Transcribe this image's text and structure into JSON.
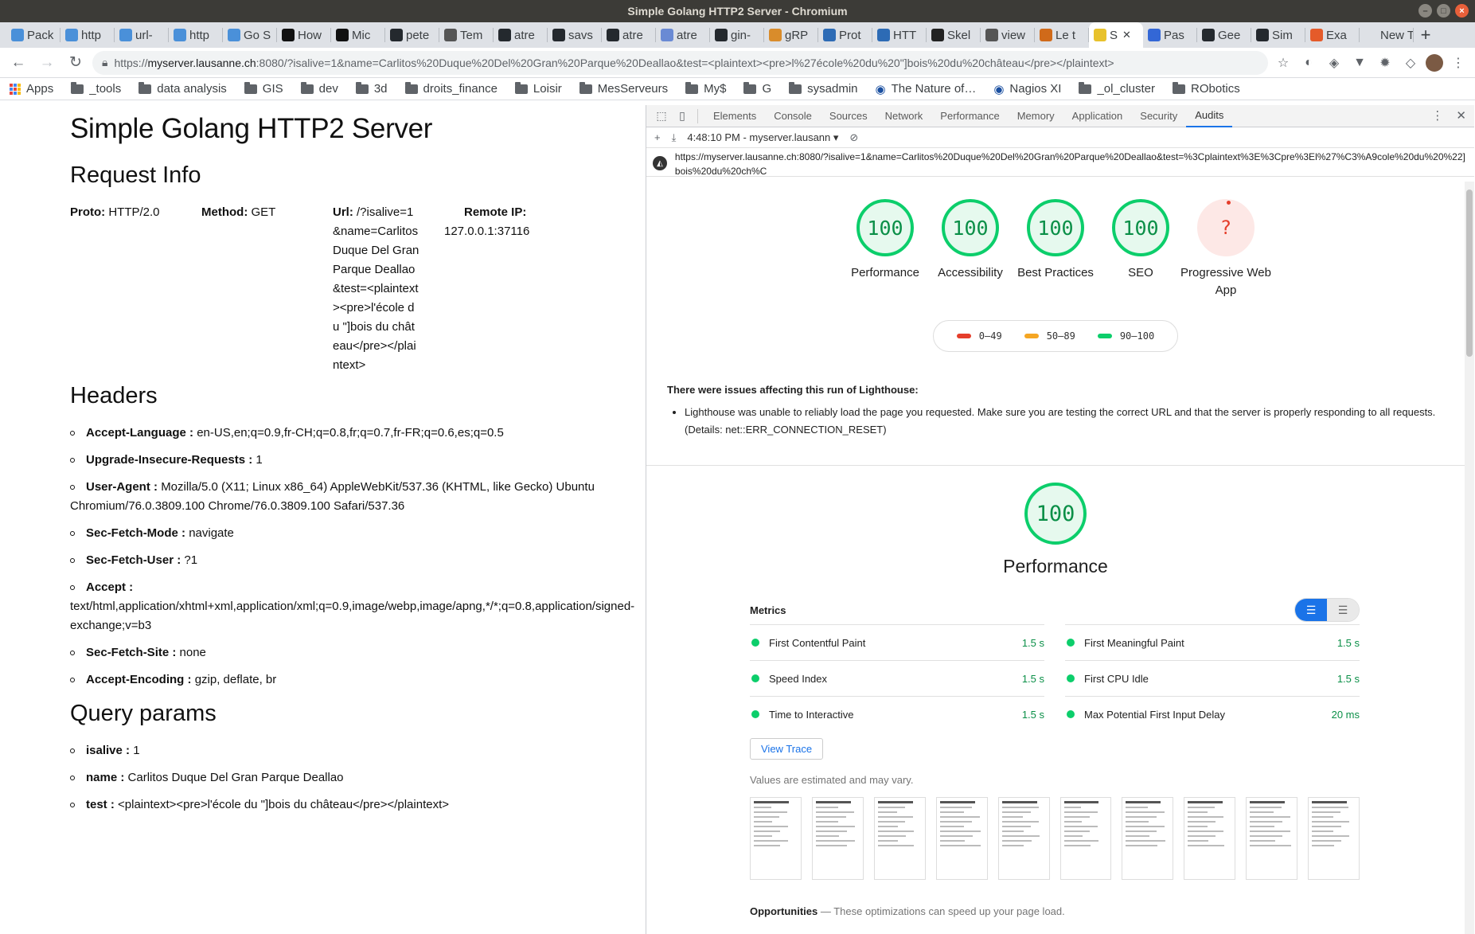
{
  "window": {
    "title": "Simple Golang HTTP2 Server - Chromium"
  },
  "tabs": [
    {
      "label": "Pack",
      "color": "#4a90d9"
    },
    {
      "label": "http",
      "color": "#4a90d9"
    },
    {
      "label": "url-",
      "color": "#4a90d9"
    },
    {
      "label": "http",
      "color": "#4a90d9"
    },
    {
      "label": "Go S",
      "color": "#4a90d9"
    },
    {
      "label": "How",
      "color": "#111111"
    },
    {
      "label": "Mic",
      "color": "#111111"
    },
    {
      "label": "pete",
      "color": "#24292e"
    },
    {
      "label": "Tem",
      "color": "#555555"
    },
    {
      "label": "atre",
      "color": "#24292e"
    },
    {
      "label": "savs",
      "color": "#24292e"
    },
    {
      "label": "atre",
      "color": "#24292e"
    },
    {
      "label": "atre",
      "color": "#6a8ad4"
    },
    {
      "label": "gin-",
      "color": "#24292e"
    },
    {
      "label": "gRP",
      "color": "#d98c2b"
    },
    {
      "label": "Prot",
      "color": "#2d6bb5"
    },
    {
      "label": "HTT",
      "color": "#2d6bb5"
    },
    {
      "label": "Skel",
      "color": "#222222"
    },
    {
      "label": "view",
      "color": "#555555"
    },
    {
      "label": "Le t",
      "color": "#d06a1a"
    },
    {
      "label": "S",
      "color": "#e8c22c",
      "active": true
    },
    {
      "label": "Pas",
      "color": "#3367d6"
    },
    {
      "label": "Gee",
      "color": "#24292e"
    },
    {
      "label": "Sim",
      "color": "#24292e"
    },
    {
      "label": "Exa",
      "color": "#e55b2a"
    },
    {
      "label": "New Ta",
      "color": "#dee1e6"
    }
  ],
  "omnibox": {
    "url_prefix": "https://",
    "host": "myserver.lausanne.ch",
    "url_rest": ":8080/?isalive=1&name=Carlitos%20Duque%20Del%20Gran%20Parque%20Deallao&test=<plaintext><pre>l%27école%20du%20\"]bois%20du%20château</pre></plaintext>"
  },
  "bookmarks": [
    {
      "label": "Apps",
      "type": "apps"
    },
    {
      "label": "_tools",
      "type": "folder"
    },
    {
      "label": "data analysis",
      "type": "folder"
    },
    {
      "label": "GIS",
      "type": "folder"
    },
    {
      "label": "dev",
      "type": "folder"
    },
    {
      "label": "3d",
      "type": "folder"
    },
    {
      "label": "droits_finance",
      "type": "folder"
    },
    {
      "label": "Loisir",
      "type": "folder"
    },
    {
      "label": "MesServeurs",
      "type": "folder"
    },
    {
      "label": "My$",
      "type": "folder"
    },
    {
      "label": "G",
      "type": "folder"
    },
    {
      "label": "sysadmin",
      "type": "folder"
    },
    {
      "label": "The Nature of…",
      "type": "site"
    },
    {
      "label": "Nagios XI",
      "type": "site"
    },
    {
      "label": "_ol_cluster",
      "type": "folder"
    },
    {
      "label": "RObotics",
      "type": "folder"
    }
  ],
  "page": {
    "title": "Simple Golang HTTP2 Server",
    "request_heading": "Request Info",
    "proto_label": "Proto:",
    "proto_value": "HTTP/2.0",
    "method_label": "Method:",
    "method_value": "GET",
    "url_label": "Url:",
    "url_value": "/?isalive=1&name=Carlitos Duque Del Gran Parque Deallao&test=<plaintext><pre>l'école du \"]bois du château</pre></plaintext>",
    "remote_label": "Remote IP:",
    "remote_value": "127.0.0.1:37116",
    "headers_heading": "Headers",
    "headers": [
      {
        "key": "Accept-Language :",
        "value": "en-US,en;q=0.9,fr-CH;q=0.8,fr;q=0.7,fr-FR;q=0.6,es;q=0.5"
      },
      {
        "key": "Upgrade-Insecure-Requests :",
        "value": "1"
      },
      {
        "key": "User-Agent :",
        "value": "Mozilla/5.0 (X11; Linux x86_64) AppleWebKit/537.36 (KHTML, like Gecko) Ubuntu Chromium/76.0.3809.100 Chrome/76.0.3809.100 Safari/537.36"
      },
      {
        "key": "Sec-Fetch-Mode :",
        "value": "navigate"
      },
      {
        "key": "Sec-Fetch-User :",
        "value": "?1"
      },
      {
        "key": "Accept :",
        "value": "text/html,application/xhtml+xml,application/xml;q=0.9,image/webp,image/apng,*/*;q=0.8,application/signed-exchange;v=b3"
      },
      {
        "key": "Sec-Fetch-Site :",
        "value": "none"
      },
      {
        "key": "Accept-Encoding :",
        "value": "gzip, deflate, br"
      }
    ],
    "query_heading": "Query params",
    "query": [
      {
        "key": "isalive :",
        "value": "1"
      },
      {
        "key": "name :",
        "value": "Carlitos Duque Del Gran Parque Deallao"
      },
      {
        "key": "test :",
        "value": "<plaintext><pre>l'école du \"]bois du château</pre></plaintext>"
      }
    ]
  },
  "devtools": {
    "tabs": [
      "Elements",
      "Console",
      "Sources",
      "Network",
      "Performance",
      "Memory",
      "Application",
      "Security",
      "Audits"
    ],
    "active_tab": "Audits",
    "report_selector": "4:48:10 PM - myserver.lausann",
    "report_url": "https://myserver.lausanne.ch:8080/?isalive=1&name=Carlitos%20Duque%20Del%20Gran%20Parque%20Deallao&test=%3Cplaintext%3E%3Cpre%3El%27%C3%A9cole%20du%20%22]bois%20du%20ch%C",
    "gauges": [
      {
        "score": "100",
        "label": "Performance"
      },
      {
        "score": "100",
        "label": "Accessibility"
      },
      {
        "score": "100",
        "label": "Best Practices"
      },
      {
        "score": "100",
        "label": "SEO"
      },
      {
        "score": "?",
        "label": "Progressive Web App"
      }
    ],
    "legend": [
      {
        "label": "0–49",
        "color": "#e53e2b"
      },
      {
        "label": "50–89",
        "color": "#f5a623"
      },
      {
        "label": "90–100",
        "color": "#0cce6b"
      }
    ],
    "warning_title": "There were issues affecting this run of Lighthouse:",
    "warning_item": "Lighthouse was unable to reliably load the page you requested. Make sure you are testing the correct URL and that the server is properly responding to all requests. (Details: net::ERR_CONNECTION_RESET)",
    "perf_score": "100",
    "perf_title": "Performance",
    "metrics_title": "Metrics",
    "metrics": [
      {
        "name": "First Contentful Paint",
        "value": "1.5 s"
      },
      {
        "name": "First Meaningful Paint",
        "value": "1.5 s"
      },
      {
        "name": "Speed Index",
        "value": "1.5 s"
      },
      {
        "name": "First CPU Idle",
        "value": "1.5 s"
      },
      {
        "name": "Time to Interactive",
        "value": "1.5 s"
      },
      {
        "name": "Max Potential First Input Delay",
        "value": "20 ms"
      }
    ],
    "view_trace": "View Trace",
    "estimated_note": "Values are estimated and may vary.",
    "opportunities_title": "Opportunities",
    "opportunities_desc": "— These optimizations can speed up your page load.",
    "colors": {
      "pass": "#0cce6b",
      "fail": "#e53e2b",
      "average": "#f5a623",
      "accent": "#1a73e8"
    }
  }
}
